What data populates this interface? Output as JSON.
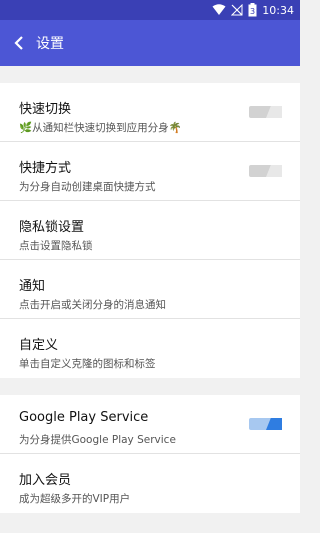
{
  "statusbar": {
    "time": "10:34",
    "battery": "3"
  },
  "appbar": {
    "title": "设置"
  },
  "settings": [
    {
      "title": "快速切换",
      "subtitle": "从通知栏快速切换到应用分身",
      "toggle": false
    },
    {
      "title": "快捷方式",
      "subtitle": "为分身自动创建桌面快捷方式",
      "toggle": false
    },
    {
      "title": "隐私锁设置",
      "subtitle": "点击设置隐私锁"
    },
    {
      "title": "通知",
      "subtitle": "点击开启或关闭分身的消息通知"
    },
    {
      "title": "自定义",
      "subtitle": "单击自定义克隆的图标和标签"
    }
  ],
  "settings2": [
    {
      "title": "Google Play Service",
      "subtitle": "为分身提供Google Play Service",
      "toggle": true
    },
    {
      "title": "加入会员",
      "subtitle": "成为超级多开的VIP用户"
    }
  ],
  "colors": {
    "statusbar": "#3a40b5",
    "appbar": "#4c56d5",
    "toggle_on": "#2f7de1"
  }
}
